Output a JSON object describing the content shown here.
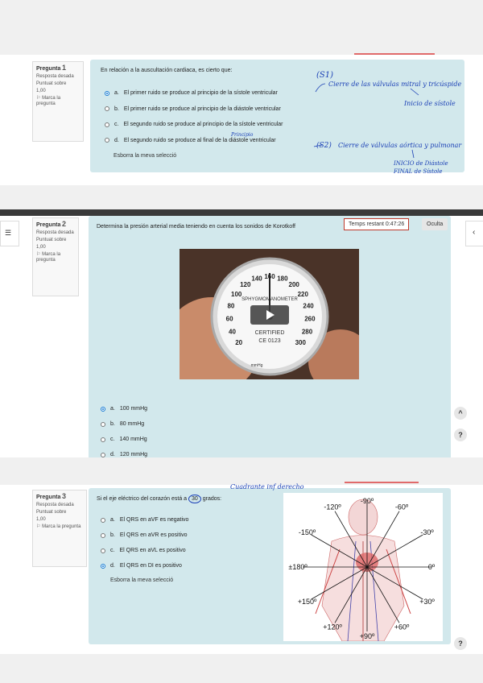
{
  "q1": {
    "label": "Pregunta",
    "number": "1",
    "status": "Resposta desada",
    "score_label": "Puntuat sobre",
    "score": "1,00",
    "flag": "Marca la pregunta",
    "question": "En relación a la auscultación cardiaca, es cierto que:",
    "options": [
      {
        "letter": "a.",
        "text": "El primer ruido se produce al principio de la sístole ventricular",
        "selected": true
      },
      {
        "letter": "b.",
        "text": "El primer ruido se produce al principio de la diástole ventricular",
        "selected": false
      },
      {
        "letter": "c.",
        "text": "El segundo ruido se produce al principio de la sístole ventricular",
        "selected": false
      },
      {
        "letter": "d.",
        "text": "El segundo ruido se produce al final de la diástole ventricular",
        "selected": false
      }
    ],
    "clear": "Esborra la meva selecció",
    "notes": {
      "s1": "(S1)",
      "s1_text": "Cierre de las válvulas mitral y tricúspide",
      "s1_sub": "Inicio de sístole",
      "principio": "Principio",
      "s2": "(S2)",
      "s2_text": "Cierre de válvulas aórtica y pulmonar",
      "s2_sub1": "INICIO de Diástole",
      "s2_sub2": "FINAL de Sístole"
    }
  },
  "q2": {
    "label": "Pregunta",
    "number": "2",
    "status": "Resposta desada",
    "score_label": "Puntuat sobre",
    "score": "1,00",
    "flag": "Marca la pregunta",
    "question": "Determina la presión arterial media teniendo en cuenta los sonidos de Korotkoff",
    "timer": "Temps restant 0:47:26",
    "hide": "Oculta",
    "options": [
      {
        "letter": "a.",
        "text": "100 mmHg",
        "selected": true
      },
      {
        "letter": "b.",
        "text": "80 mmHg",
        "selected": false
      },
      {
        "letter": "c.",
        "text": "140 mmHg",
        "selected": false
      },
      {
        "letter": "d.",
        "text": "120 mmHg",
        "selected": false
      }
    ],
    "gauge": {
      "ticks": [
        "20",
        "40",
        "60",
        "80",
        "100",
        "120",
        "140",
        "160",
        "180",
        "200",
        "220",
        "240",
        "260",
        "280",
        "300"
      ],
      "brand": "SPHYGMOMANOMETER",
      "certified": "CERTIFIED",
      "ce": "CE 0123",
      "unit": "mmHg"
    }
  },
  "q3": {
    "label": "Pregunta",
    "number": "3",
    "status": "Resposta desada",
    "score_label": "Puntuat sobre",
    "score": "1,00",
    "flag": "Marca la pregunta",
    "question_pre": "Si el eje eléctrico del corazón está a",
    "question_val": "30",
    "question_post": "grados:",
    "note": "Cuadrante inf derecho",
    "options": [
      {
        "letter": "a.",
        "text": "El QRS en aVF es negativo",
        "selected": false
      },
      {
        "letter": "b.",
        "text": "El QRS en aVR es positivo",
        "selected": false
      },
      {
        "letter": "c.",
        "text": "El QRS en aVL es positivo",
        "selected": false
      },
      {
        "letter": "d.",
        "text": "El QRS en DI es positivo",
        "selected": true
      }
    ],
    "clear": "Esborra la meva selecció",
    "angles": [
      "-90º",
      "-120º",
      "-60º",
      "-150º",
      "-30º",
      "±180º",
      "0º",
      "+150º",
      "+30º",
      "+120º",
      "+60º",
      "+90º"
    ]
  },
  "help": "?",
  "up": "^"
}
